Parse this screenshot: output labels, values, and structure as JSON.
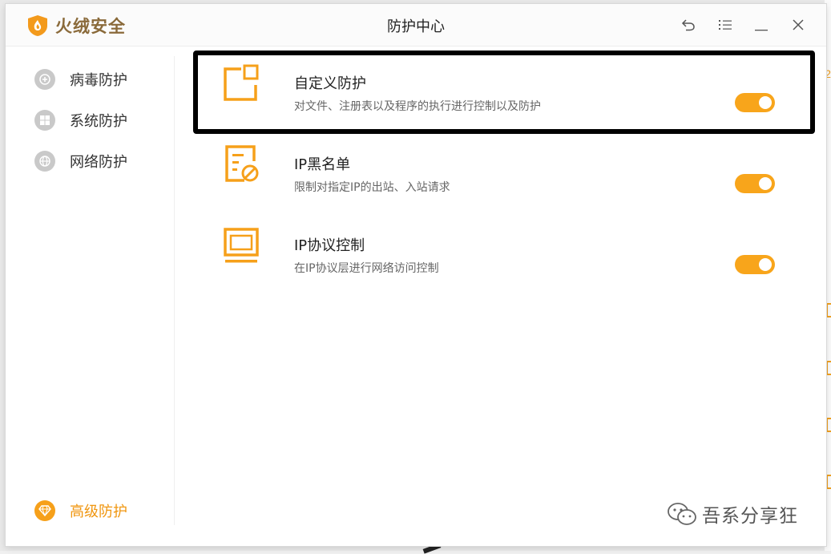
{
  "window": {
    "brand": "火绒安全",
    "title": "防护中心"
  },
  "titlebar_buttons": {
    "back": "back-icon",
    "menu": "menu-icon",
    "minimize": "minimize-icon",
    "close": "close-icon"
  },
  "sidebar": {
    "items": [
      {
        "label": "病毒防护",
        "icon": "plus-circle-icon",
        "active": false
      },
      {
        "label": "系统防护",
        "icon": "windows-icon",
        "active": false
      },
      {
        "label": "网络防护",
        "icon": "globe-icon",
        "active": false
      }
    ],
    "bottom_item": {
      "label": "高级防护",
      "icon": "diamond-icon",
      "active": true
    }
  },
  "content": {
    "rows": [
      {
        "title": "自定义防护",
        "desc": "对文件、注册表以及程序的执行进行控制以及防护",
        "icon": "custom-protection-icon",
        "enabled": true
      },
      {
        "title": "IP黑名单",
        "desc": "限制对指定IP的出站、入站请求",
        "icon": "ip-blacklist-icon",
        "enabled": true
      },
      {
        "title": "IP协议控制",
        "desc": "在IP协议层进行网络访问控制",
        "icon": "ip-protocol-icon",
        "enabled": true
      }
    ]
  },
  "watermark": {
    "text": "吾系分享狂",
    "icon": "wechat-icon"
  },
  "colors": {
    "accent": "#f8a51b",
    "brand": "#8a6a3a",
    "highlight": "#000000"
  }
}
